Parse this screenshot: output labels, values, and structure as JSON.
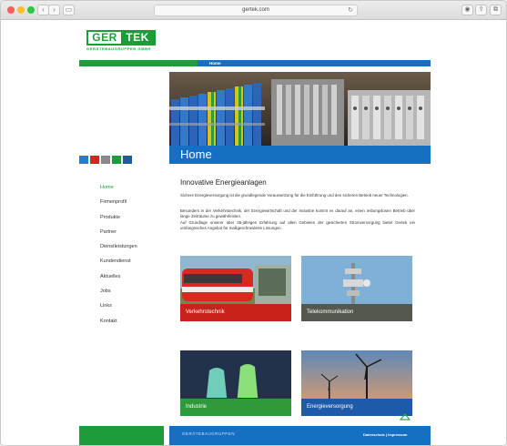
{
  "browser": {
    "url": "gertek.com",
    "nav_back": "‹",
    "nav_forward": "›",
    "sidebar_toggle": "▭",
    "reload": "↻",
    "shield": "◉",
    "share": "⇪",
    "tabs": "⧉"
  },
  "logo": {
    "part1": "GER",
    "part2": "TEK",
    "sub": "GERÄTEBAUGRUPPEN GMBH"
  },
  "breadcrumb": "Home",
  "hero_title": "Home",
  "color_squares": [
    "#1f7fd4",
    "#d0281e",
    "#8a8a8a",
    "#1f9c3a",
    "#1d5aa8"
  ],
  "nav": {
    "items": [
      "Home",
      "Firmenprofil",
      "Produkte",
      "Partner",
      "Dienstleistungen",
      "Kundendienst",
      "Aktuelles",
      "Jobs",
      "Links",
      "Kontakt"
    ],
    "active_index": 0
  },
  "content": {
    "heading": "Innovative Energieanlagen",
    "p1": "Sichere Energieversorgung ist die grundlegende Voraussetzung für die Einführung und den sicheren Betrieb neuer Technologien.",
    "p2": "Besonders in der Verkehrstechnik, der Energiewirtschaft und der Industrie kommt es darauf an, einen reibungslosen Betrieb über lange Zeiträume zu gewährleisten.",
    "p3": "Auf Grundlage unserer über 35-jährigen Erfahrung auf allen Gebieten der gesicherten Stromversorgung bietet Gertek ein umfangreiches Angebot für maßgeschneiderte Lösungen."
  },
  "tiles": [
    {
      "label": "Verkehrstechnik",
      "color": "#c9221c"
    },
    {
      "label": "Telekommunikation",
      "color": "#55584f"
    },
    {
      "label": "Industrie",
      "color": "#2e9a3a"
    },
    {
      "label": "Energieversorgung",
      "color": "#1d5aa8"
    }
  ],
  "footer": {
    "logo_text": "GERÄTEBAUGRUPPEN",
    "links": "Datenschutz | Impressum"
  },
  "colors": {
    "green": "#1f9c3a",
    "blue": "#1570c4"
  }
}
